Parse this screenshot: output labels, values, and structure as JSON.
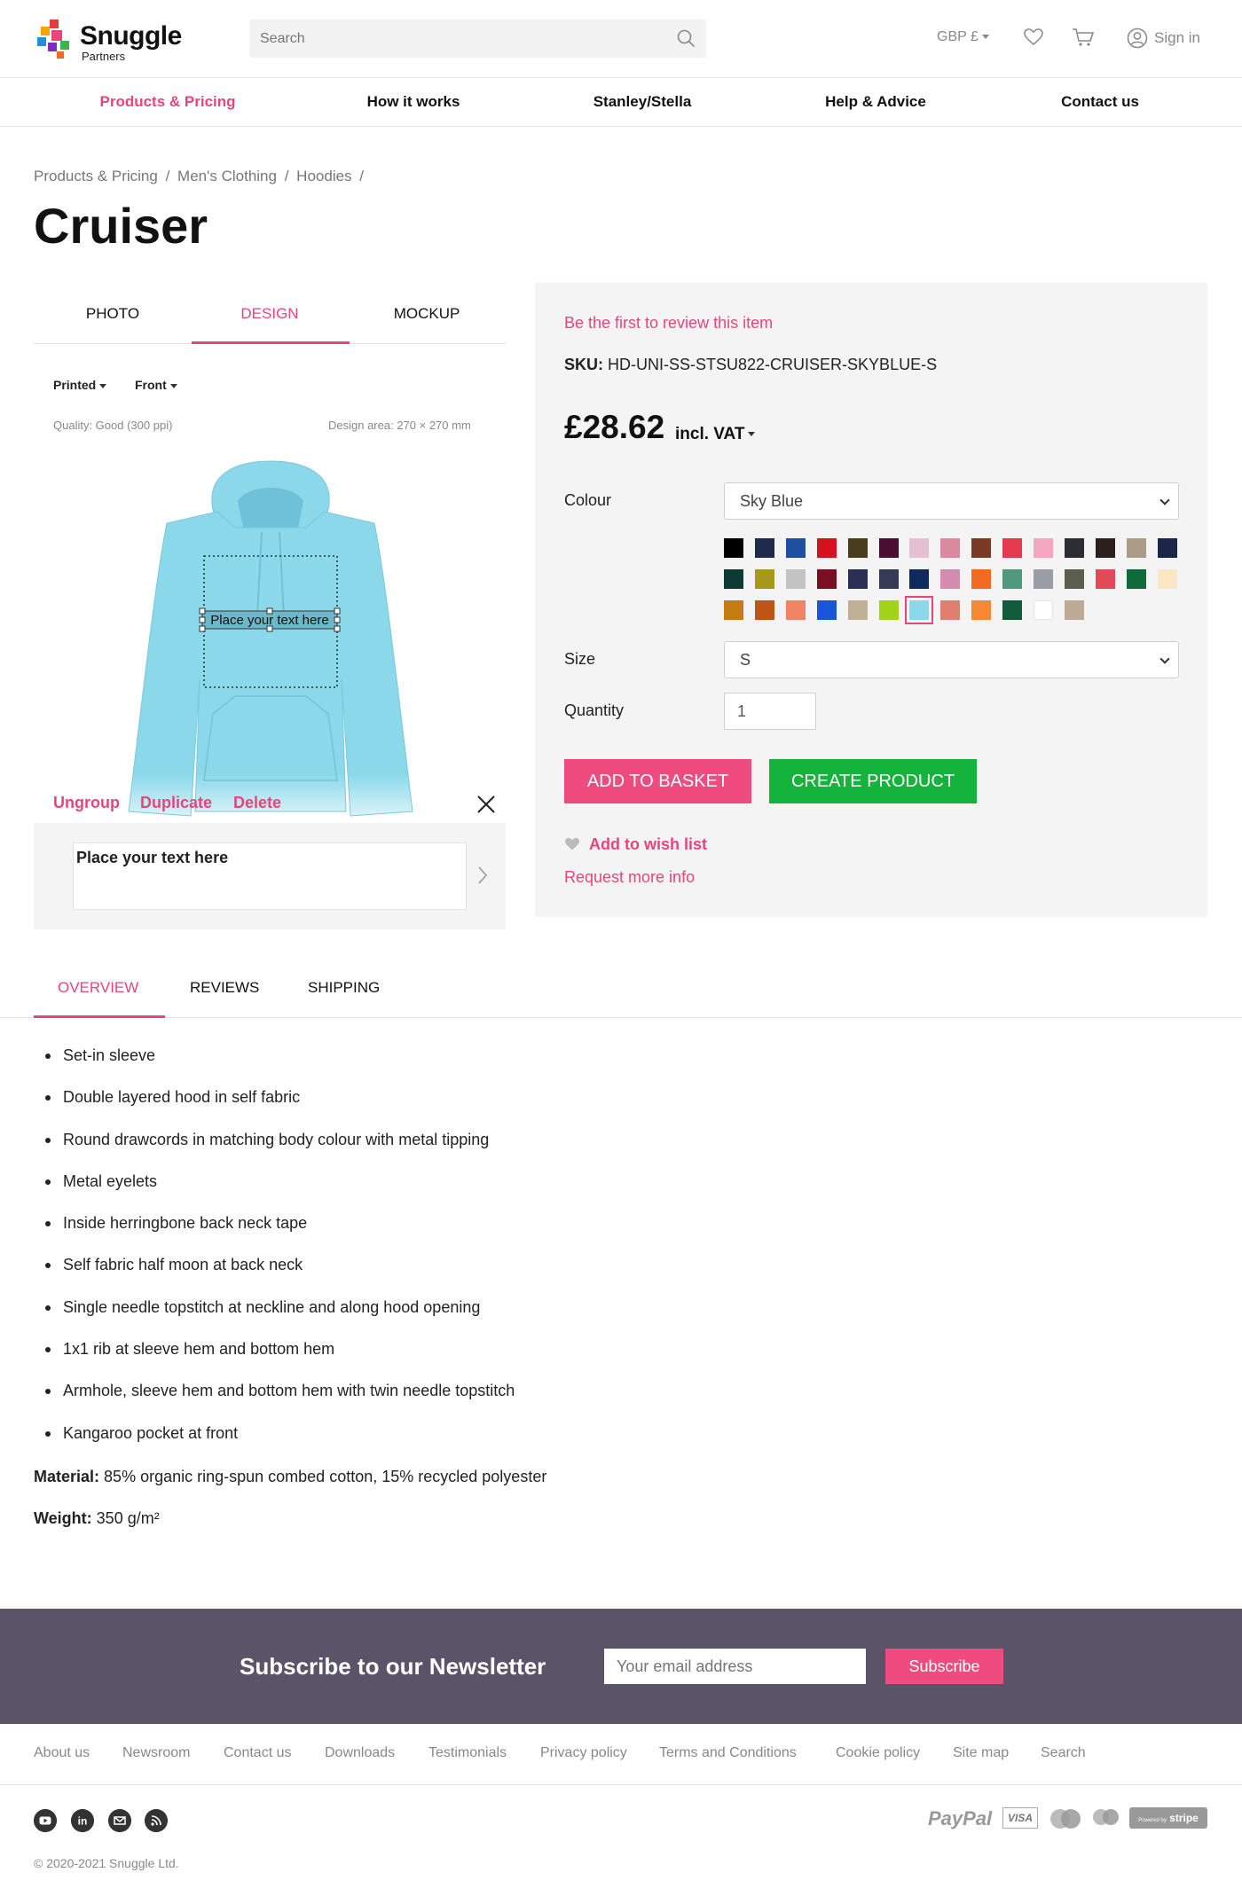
{
  "header": {
    "brand": "Snuggle",
    "brand_sub": "Partners",
    "search_placeholder": "Search",
    "currency": "GBP £",
    "sign_in": "Sign in"
  },
  "nav": [
    {
      "label": "Products & Pricing"
    },
    {
      "label": "How it works"
    },
    {
      "label": "Stanley/Stella"
    },
    {
      "label": "Help & Advice"
    },
    {
      "label": "Contact us"
    }
  ],
  "breadcrumb": [
    "Products & Pricing",
    "/",
    "Men's Clothing",
    "/",
    "Hoodies",
    "/"
  ],
  "product": {
    "title": "Cruiser",
    "view_tabs": [
      "PHOTO",
      "DESIGN",
      "MOCKUP"
    ],
    "print_method": "Printed",
    "side": "Front",
    "quality": "Quality: Good (300 ppi)",
    "design_area": "Design area: 270 × 270 mm",
    "placeholder_text": "Place your text here",
    "actions": [
      "Ungroup",
      "Duplicate",
      "Delete"
    ],
    "text_field_value": "Place your text here"
  },
  "purchase": {
    "review_link": "Be the first to review this item",
    "sku_label": "SKU:",
    "sku_value": "HD-UNI-SS-STSU822-CRUISER-SKYBLUE-S",
    "price": "£28.62",
    "vat": "incl. VAT",
    "colour_label": "Colour",
    "colour_value": "Sky Blue",
    "size_label": "Size",
    "size_value": "S",
    "quantity_label": "Quantity",
    "quantity_value": "1",
    "add_to_basket": "ADD TO BASKET",
    "create_product": "CREATE PRODUCT",
    "wishlist": "Add to wish list",
    "request_info": "Request more info",
    "swatches": [
      "#000000",
      "#1e2a4a",
      "#1f4fa0",
      "#d6101e",
      "#4a3d1e",
      "#4a0f30",
      "#e5bfd2",
      "#d98aa0",
      "#7b3a26",
      "#e33a4f",
      "#f4a6c0",
      "#2b2d33",
      "#2d1f1d",
      "#ab9b87",
      "#1a2547",
      "#0e3a36",
      "#a5981a",
      "#c4c4c4",
      "#7b0f22",
      "#2b2f55",
      "#353b54",
      "#0e2a5e",
      "#d58ab0",
      "#f26a23",
      "#4e9a7e",
      "#9a9ca6",
      "#5c5f4d",
      "#e24a58",
      "#0f6b3a",
      "#fbe7c4",
      "#c67a12",
      "#bf5417",
      "#f28466",
      "#1756d8",
      "#bfb096",
      "#a2d318",
      "#8ad8ea",
      "#e07f6f",
      "#f48835",
      "#0f5d3a",
      "#ffffff",
      "#bfaa98"
    ],
    "selected_swatch": 36
  },
  "overview": {
    "tabs": [
      "OVERVIEW",
      "REVIEWS",
      "SHIPPING"
    ],
    "features": [
      "Set-in sleeve",
      "Double layered hood in self fabric",
      "Round drawcords in matching body colour with metal tipping",
      "Metal eyelets",
      "Inside herringbone back neck tape",
      "Self fabric half moon at back neck",
      "Single needle topstitch at neckline and along hood opening",
      "1x1 rib at sleeve hem and bottom hem",
      "Armhole, sleeve hem and bottom hem with twin needle topstitch",
      "Kangaroo pocket at front"
    ],
    "material_label": "Material:",
    "material_value": "85% organic ring-spun combed cotton, 15% recycled polyester",
    "weight_label": "Weight:",
    "weight_value": "350 g/m²"
  },
  "newsletter": {
    "title": "Subscribe to our Newsletter",
    "placeholder": "Your email address",
    "button": "Subscribe"
  },
  "footer": {
    "links": [
      "About us",
      "Newsroom",
      "Contact us",
      "Downloads",
      "Testimonials",
      "Privacy policy",
      "Terms and Conditions",
      "Cookie policy",
      "Site map",
      "Search"
    ],
    "payment": {
      "paypal": "PayPal",
      "visa": "VISA",
      "stripe": "stripe",
      "stripe_prefix": "Powered by"
    },
    "social_icons": [
      "youtube-icon",
      "linkedin-icon",
      "email-icon",
      "rss-icon"
    ],
    "copyright": "© 2020-2021 Snuggle Ltd."
  },
  "colors": {
    "accent": "#e9457a",
    "basket": "#f04b7e",
    "create": "#14b33c",
    "newsletter_bg": "#5a5468",
    "garment": "#8ad8ea"
  }
}
